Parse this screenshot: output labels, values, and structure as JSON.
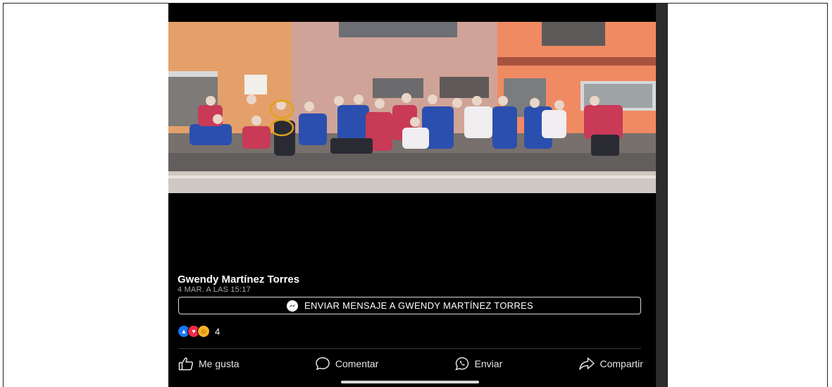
{
  "post": {
    "author": "Gwendy Martínez Torres",
    "timestamp": "4 MAR. A LAS 15:17",
    "message_button": "ENVIAR MENSAJE A GWENDY MARTÍNEZ TORRES",
    "reaction_count": "4",
    "reactions": [
      "like-icon",
      "love-icon",
      "haha-icon"
    ]
  },
  "actions": {
    "like": "Me gusta",
    "comment": "Comentar",
    "send": "Enviar",
    "share": "Compartir"
  },
  "photo": {
    "subject": "group-photo",
    "highlight_color": "#e0a21a"
  },
  "colors": {
    "background": "#000000",
    "messenger": "#ffffff",
    "like": "#1877f2",
    "love": "#f02849",
    "haha": "#f7b125"
  }
}
